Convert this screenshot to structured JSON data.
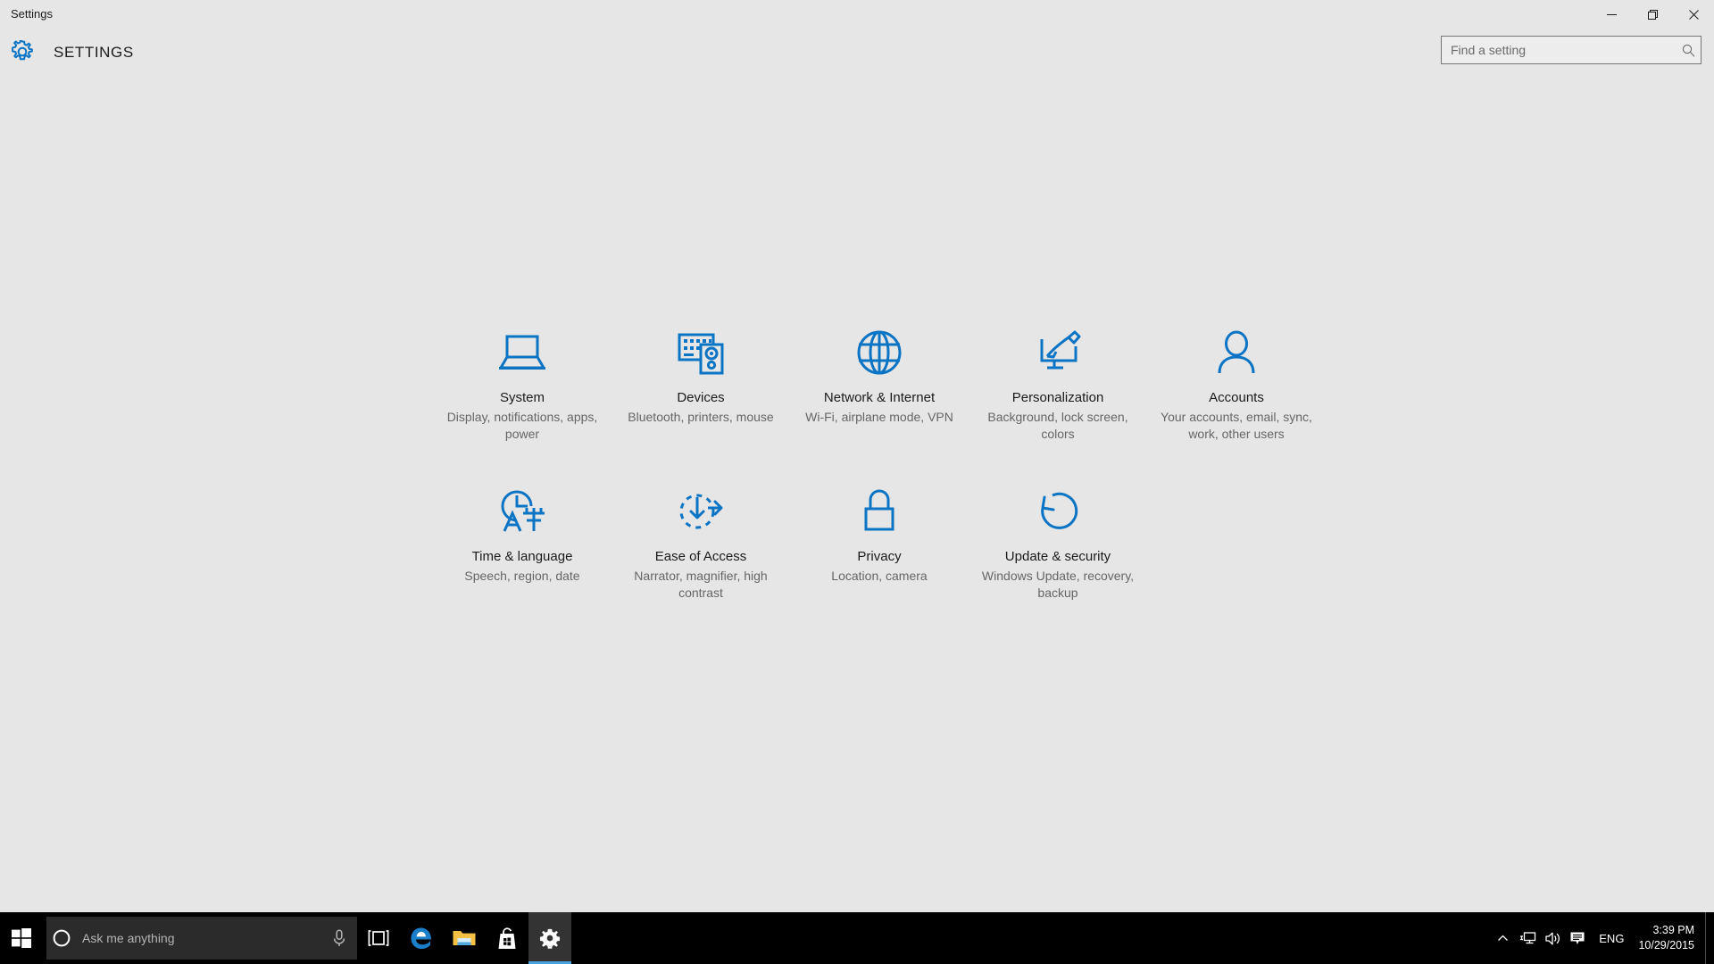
{
  "window": {
    "title": "Settings",
    "minimize_label": "Minimize",
    "maximize_label": "Restore",
    "close_label": "Close"
  },
  "header": {
    "title": "SETTINGS",
    "gear_icon": "gear-icon"
  },
  "search": {
    "placeholder": "Find a setting",
    "value": "",
    "icon": "search-icon"
  },
  "accent_color": "#0b74c4",
  "page_background": "#e6e6e6",
  "taskbar_background": "#000000",
  "tiles": [
    {
      "id": "system",
      "icon": "laptop-icon",
      "title": "System",
      "desc": "Display, notifications, apps, power"
    },
    {
      "id": "devices",
      "icon": "keyboard-printer-icon",
      "title": "Devices",
      "desc": "Bluetooth, printers, mouse"
    },
    {
      "id": "network-internet",
      "icon": "globe-icon",
      "title": "Network & Internet",
      "desc": "Wi-Fi, airplane mode, VPN"
    },
    {
      "id": "personalization",
      "icon": "monitor-brush-icon",
      "title": "Personalization",
      "desc": "Background, lock screen, colors"
    },
    {
      "id": "accounts",
      "icon": "person-icon",
      "title": "Accounts",
      "desc": "Your accounts, email, sync, work, other users"
    },
    {
      "id": "time-language",
      "icon": "clock-language-icon",
      "title": "Time & language",
      "desc": "Speech, region, date"
    },
    {
      "id": "ease-of-access",
      "icon": "accessibility-clock-icon",
      "title": "Ease of Access",
      "desc": "Narrator, magnifier, high contrast"
    },
    {
      "id": "privacy",
      "icon": "lock-icon",
      "title": "Privacy",
      "desc": "Location, camera"
    },
    {
      "id": "update-security",
      "icon": "refresh-icon",
      "title": "Update & security",
      "desc": "Windows Update, recovery, backup"
    }
  ],
  "taskbar": {
    "start_label": "Start",
    "cortana": {
      "placeholder": "Ask me anything",
      "value": "",
      "ring_icon": "cortana-circle-icon",
      "mic_icon": "microphone-icon"
    },
    "buttons": [
      {
        "id": "task-view",
        "icon": "task-view-icon",
        "label": "Task View",
        "active": false
      },
      {
        "id": "edge",
        "icon": "edge-icon",
        "label": "Microsoft Edge",
        "active": false
      },
      {
        "id": "file-explorer",
        "icon": "folder-icon",
        "label": "File Explorer",
        "active": false
      },
      {
        "id": "store",
        "icon": "store-bag-icon",
        "label": "Store",
        "active": false
      },
      {
        "id": "settings",
        "icon": "gear-icon",
        "label": "Settings",
        "active": true
      }
    ],
    "tray": {
      "chevron_icon": "chevron-up-icon",
      "network_icon": "network-icon",
      "volume_icon": "speaker-icon",
      "action_center_icon": "action-center-icon",
      "language": "ENG",
      "time": "3:39 PM",
      "date": "10/29/2015"
    }
  }
}
